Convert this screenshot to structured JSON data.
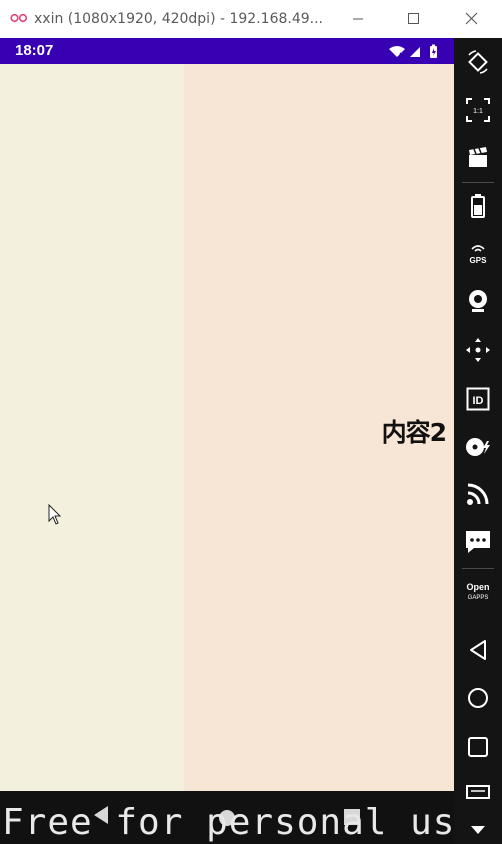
{
  "window": {
    "title": "xxin (1080x1920, 420dpi) - 192.168.49...",
    "icons": [
      "app-logo-icon",
      "minimize-icon",
      "maximize-icon",
      "close-icon"
    ]
  },
  "statusbar": {
    "time": "18:07",
    "color": "#3700b3",
    "icons": [
      "wifi-icon",
      "signal-icon",
      "battery-icon"
    ]
  },
  "content": {
    "label": "内容2",
    "left_color": "#f3f1de",
    "right_color": "#f7e6d5"
  },
  "navbar": {
    "watermark": "Free for personal use",
    "icons": [
      "back-icon",
      "home-icon",
      "recents-icon"
    ]
  },
  "toolbar": {
    "items": [
      "rotate-icon",
      "fullscreen-icon",
      "screenrecord-icon",
      "battery-icon",
      "gps-icon",
      "camera-icon",
      "dpad-icon",
      "id-icon",
      "disk-icon",
      "cast-icon",
      "sms-icon",
      "opengapps-icon",
      "back-icon",
      "home-icon",
      "recents-icon",
      "menu-icon",
      "more-icon"
    ],
    "gps_label": "GPS",
    "id_label": "ID",
    "fit_label": "1:1",
    "opengapps_label_1": "Open",
    "opengapps_label_2": "GAPPS"
  }
}
